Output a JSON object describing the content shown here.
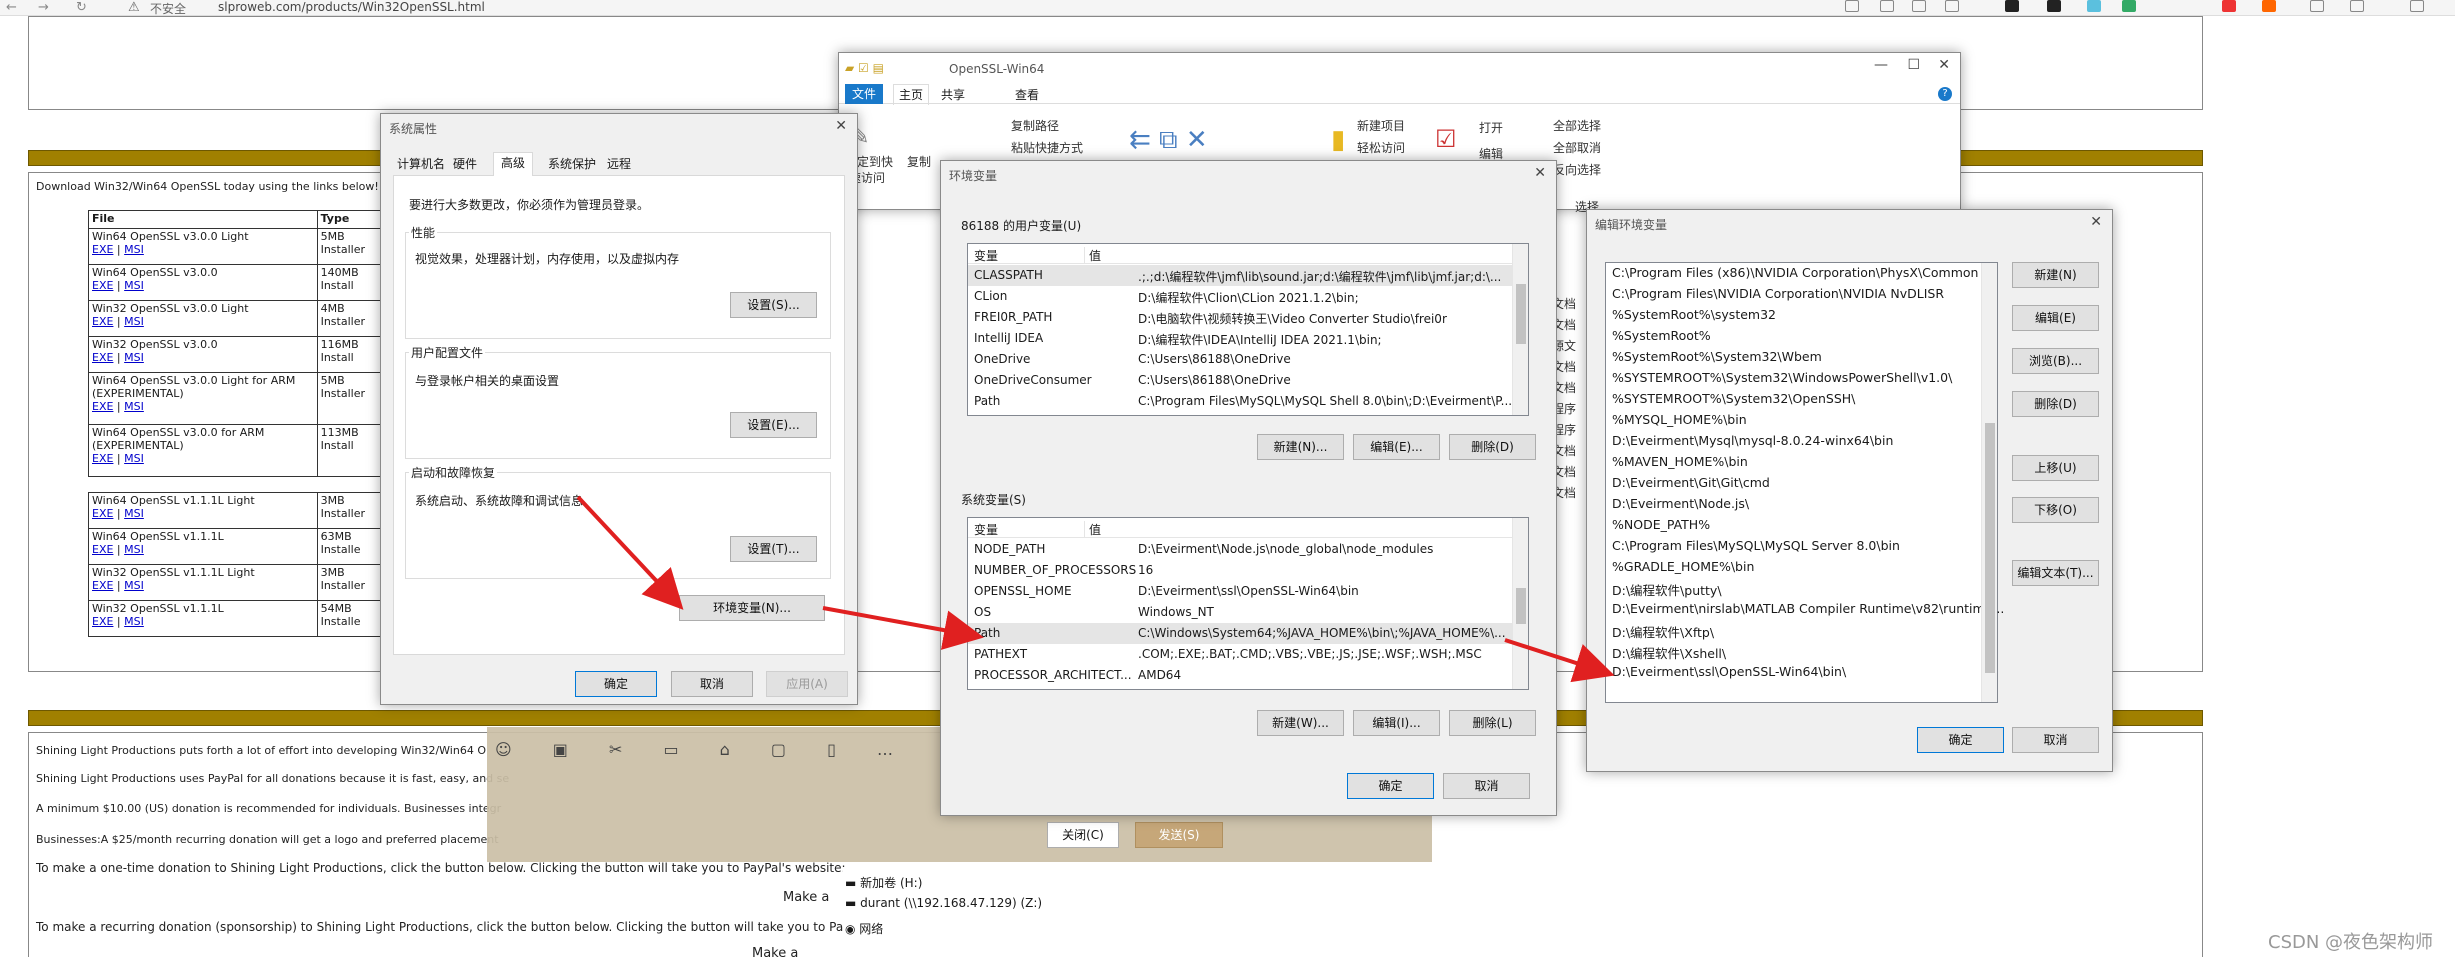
{
  "browser": {
    "security": "不安全",
    "url": "slproweb.com/products/Win32OpenSSL.html"
  },
  "webpage": {
    "download_intro": "Download Win32/Win64 OpenSSL today using the links below!",
    "table_headers": [
      "File",
      "Type"
    ],
    "rows": [
      {
        "name": "Win64 OpenSSL v3.0.0 Light",
        "type": "5MB Installer"
      },
      {
        "name": "Win64 OpenSSL v3.0.0",
        "type": "140MB Install"
      },
      {
        "name": "Win32 OpenSSL v3.0.0 Light",
        "type": "4MB Installer"
      },
      {
        "name": "Win32 OpenSSL v3.0.0",
        "type": "116MB Install"
      },
      {
        "name": "Win64 OpenSSL v3.0.0 Light for ARM (EXPERIMENTAL)",
        "type": "5MB Installer"
      },
      {
        "name": "Win64 OpenSSL v3.0.0 for ARM (EXPERIMENTAL)",
        "type": "113MB Install"
      },
      {
        "name": "Win64 OpenSSL v1.1.1L Light",
        "type": "3MB Installer"
      },
      {
        "name": "Win64 OpenSSL v1.1.1L",
        "type": "63MB Installe"
      },
      {
        "name": "Win32 OpenSSL v1.1.1L Light",
        "type": "3MB Installer"
      },
      {
        "name": "Win32 OpenSSL v1.1.1L",
        "type": "54MB Installe"
      }
    ],
    "links": {
      "exe": "EXE",
      "msi": "MSI",
      "sep": " | "
    },
    "para1": "Shining Light Productions puts forth a lot of effort into developing Win32/Win64 O",
    "para2": "Shining Light Productions uses PayPal for all donations because it is fast, easy, and se",
    "para3": "A minimum $10.00 (US) donation is recommended for individuals. Businesses integr",
    "para4": "Businesses:A $25/month recurring donation will get a logo and preferred placement",
    "onetime_text": "To make a one-time donation to Shining Light Productions, click the button below. Clicking the button will take you to PayPal's website:",
    "recurring_text": "To make a recurring donation (sponsorship) to Shining Light Productions, click the button below. Clicking the button will take you to PayPal's websit",
    "make_a": "Make a",
    "make_a2": "Make a",
    "watermark": "CSDN @夜色架构师"
  },
  "sysprops": {
    "title": "系统属性",
    "tabs": [
      "计算机名",
      "硬件",
      "高级",
      "系统保护",
      "远程"
    ],
    "admin_note": "要进行大多数更改，你必须作为管理员登录。",
    "perf_label": "性能",
    "perf_desc": "视觉效果，处理器计划，内存使用，以及虚拟内存",
    "perf_btn": "设置(S)...",
    "profile_label": "用户配置文件",
    "profile_desc": "与登录帐户相关的桌面设置",
    "profile_btn": "设置(E)...",
    "startup_label": "启动和故障恢复",
    "startup_desc": "系统启动、系统故障和调试信息",
    "startup_btn": "设置(T)...",
    "env_btn": "环境变量(N)...",
    "ok": "确定",
    "cancel": "取消",
    "apply": "应用(A)"
  },
  "explorer": {
    "title": "OpenSSL-Win64",
    "tabs": [
      "文件",
      "主页",
      "共享",
      "查看"
    ],
    "copy_path": "复制路径",
    "paste_shortcut": "粘贴快捷方式",
    "pin": "固定到快",
    "pin2": "速访问",
    "copy": "复制",
    "new_item": "新建项目",
    "easy_access": "轻松访问",
    "open": "打开",
    "edit": "编辑",
    "select_all": "全部选择",
    "select_none": "全部取消",
    "invert": "反向选择",
    "select": "选择",
    "side_items": [
      "文档",
      "文档",
      "源文",
      "文档",
      "文档",
      "程序",
      "程序",
      "文档",
      "文档",
      "文档"
    ],
    "drives": [
      {
        "name": "新加卷 (H:)"
      },
      {
        "name": "durant (\\\\192.168.47.129) (Z:)"
      },
      {
        "name": "网络"
      }
    ]
  },
  "envvars": {
    "title": "环境变量",
    "user_label": "86188 的用户变量(U)",
    "col_var": "变量",
    "col_val": "值",
    "user_vars": [
      {
        "name": "CLASSPATH",
        "value": ".;.;d:\\编程软件\\jmf\\lib\\sound.jar;d:\\编程软件\\jmf\\lib\\jmf.jar;d:\\..."
      },
      {
        "name": "CLion",
        "value": "D:\\编程软件\\Clion\\CLion 2021.1.2\\bin;"
      },
      {
        "name": "FREI0R_PATH",
        "value": "D:\\电脑软件\\视频转换王\\Video Converter Studio\\frei0r"
      },
      {
        "name": "IntelliJ IDEA",
        "value": "D:\\编程软件\\IDEA\\IntelliJ IDEA 2021.1\\bin;"
      },
      {
        "name": "OneDrive",
        "value": "C:\\Users\\86188\\OneDrive"
      },
      {
        "name": "OneDriveConsumer",
        "value": "C:\\Users\\86188\\OneDrive"
      },
      {
        "name": "Path",
        "value": "C:\\Program Files\\MySQL\\MySQL Shell 8.0\\bin\\;D:\\Eveirment\\P..."
      }
    ],
    "user_new": "新建(N)...",
    "user_edit": "编辑(E)...",
    "user_delete": "删除(D)",
    "sys_label": "系统变量(S)",
    "sys_vars": [
      {
        "name": "NODE_PATH",
        "value": "D:\\Eveirment\\Node.js\\node_global\\node_modules"
      },
      {
        "name": "NUMBER_OF_PROCESSORS",
        "value": "16"
      },
      {
        "name": "OPENSSL_HOME",
        "value": "D:\\Eveirment\\ssl\\OpenSSL-Win64\\bin"
      },
      {
        "name": "OS",
        "value": "Windows_NT"
      },
      {
        "name": "Path",
        "value": "C:\\Windows\\System64;%JAVA_HOME%\\bin\\;%JAVA_HOME%\\..."
      },
      {
        "name": "PATHEXT",
        "value": ".COM;.EXE;.BAT;.CMD;.VBS;.VBE;.JS;.JSE;.WSF;.WSH;.MSC"
      },
      {
        "name": "PROCESSOR_ARCHITECT...",
        "value": "AMD64"
      }
    ],
    "sys_new": "新建(W)...",
    "sys_edit": "编辑(I)...",
    "sys_delete": "删除(L)",
    "ok": "确定",
    "cancel": "取消"
  },
  "editenv": {
    "title": "编辑环境变量",
    "paths": [
      "C:\\Program Files (x86)\\NVIDIA Corporation\\PhysX\\Common",
      "C:\\Program Files\\NVIDIA Corporation\\NVIDIA NvDLISR",
      "%SystemRoot%\\system32",
      "%SystemRoot%",
      "%SystemRoot%\\System32\\Wbem",
      "%SYSTEMROOT%\\System32\\WindowsPowerShell\\v1.0\\",
      "%SYSTEMROOT%\\System32\\OpenSSH\\",
      "%MYSQL_HOME%\\bin",
      "D:\\Eveirment\\Mysql\\mysql-8.0.24-winx64\\bin",
      "%MAVEN_HOME%\\bin",
      "D:\\Eveirment\\Git\\Git\\cmd",
      "D:\\Eveirment\\Node.js\\",
      "%NODE_PATH%",
      "C:\\Program Files\\MySQL\\MySQL Server 8.0\\bin",
      "%GRADLE_HOME%\\bin",
      "D:\\编程软件\\putty\\",
      "D:\\Eveirment\\nirslab\\MATLAB Compiler Runtime\\v82\\runtime...",
      "D:\\编程软件\\Xftp\\",
      "D:\\编程软件\\Xshell\\",
      "D:\\Eveirment\\ssl\\OpenSSL-Win64\\bin\\"
    ],
    "new": "新建(N)",
    "edit": "编辑(E)",
    "browse": "浏览(B)...",
    "delete": "删除(D)",
    "up": "上移(U)",
    "down": "下移(O)",
    "edit_text": "编辑文本(T)...",
    "ok": "确定",
    "cancel": "取消"
  },
  "chat": {
    "close": "关闭(C)",
    "send": "发送(S)"
  },
  "colors": {
    "band": "#a08000",
    "arrow": "#e02020",
    "accent": "#0078d7"
  }
}
